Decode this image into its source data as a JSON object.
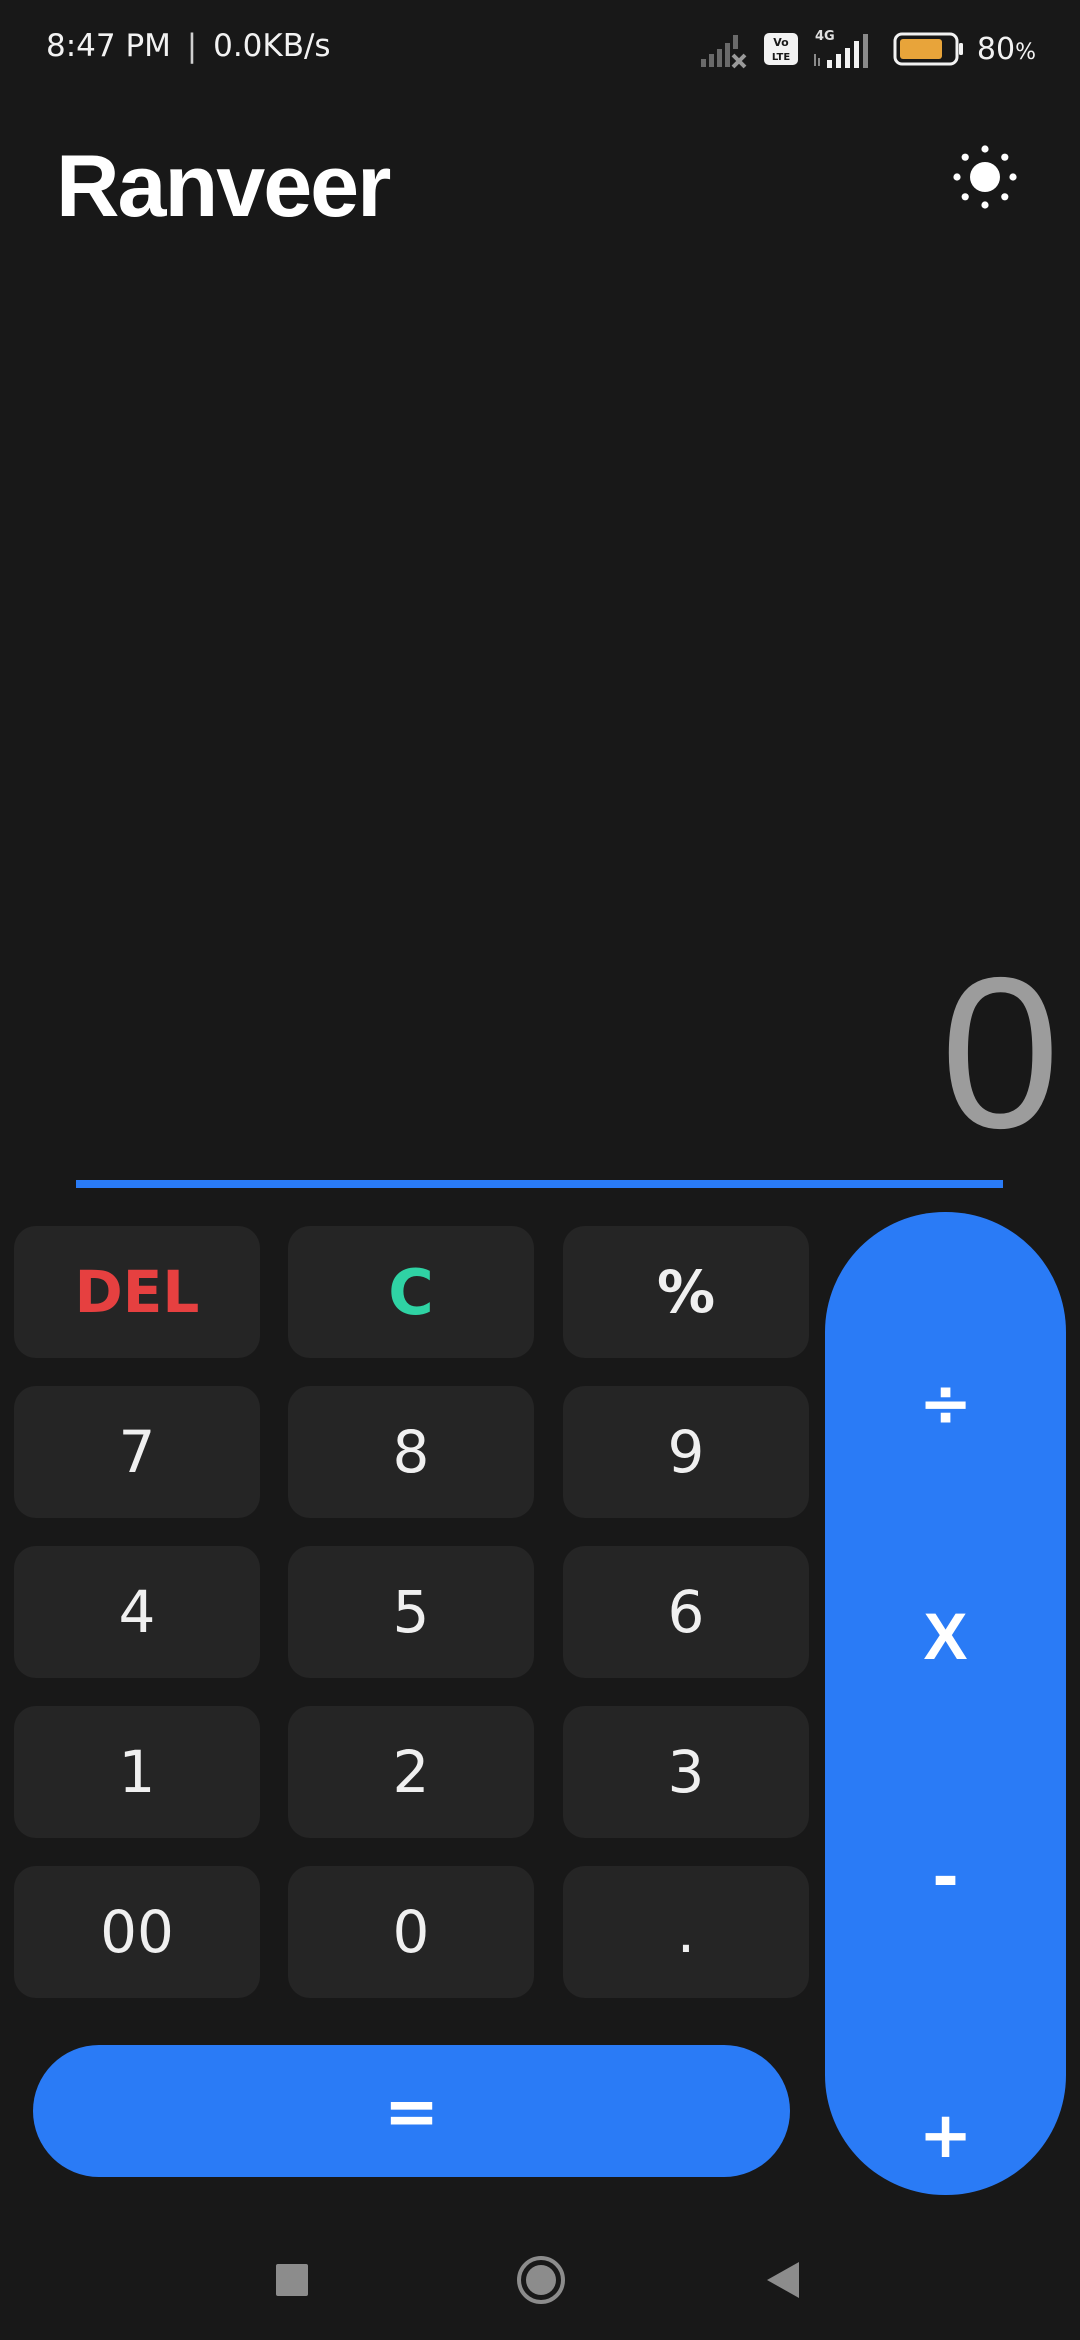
{
  "status_bar": {
    "time": "8:47 PM",
    "separator": "|",
    "net_speed": "0.0KB/s",
    "network": "4G",
    "volte_top": "Vo",
    "volte_bottom": "LTE",
    "battery_percent": "80",
    "battery_percent_sign": "%",
    "battery_level": 0.8,
    "battery_color": "#e8a43a"
  },
  "header": {
    "title": "Ranveer",
    "theme_icon": "sun-icon"
  },
  "display": {
    "value": "0"
  },
  "keypad": {
    "del": "DEL",
    "clear": "C",
    "percent": "%",
    "seven": "7",
    "eight": "8",
    "nine": "9",
    "four": "4",
    "five": "5",
    "six": "6",
    "one": "1",
    "two": "2",
    "three": "3",
    "double_zero": "00",
    "zero": "0",
    "decimal": ".",
    "equals": "="
  },
  "operators": {
    "divide": "÷",
    "multiply": "X",
    "minus": "-",
    "plus": "+"
  },
  "colors": {
    "accent": "#2a7bf6",
    "background": "#181818",
    "key_background": "#252525",
    "delete": "#e64040",
    "clear": "#2fd3a4",
    "display_text": "#9c9c9c"
  },
  "nav": {
    "recents_icon": "square-icon",
    "home_icon": "circle-icon",
    "back_icon": "triangle-back-icon"
  }
}
